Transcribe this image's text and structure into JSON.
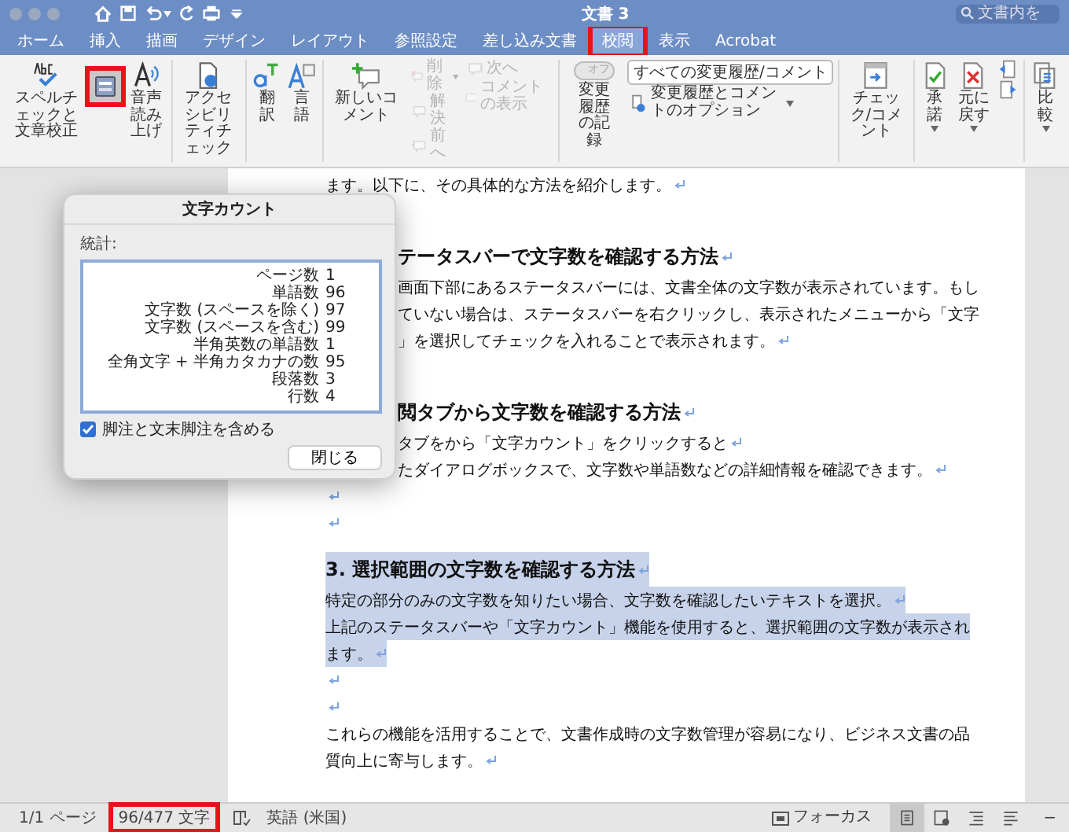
{
  "window": {
    "title": "文書 3",
    "search": {
      "placeholder": "文書内を"
    }
  },
  "quick_access": [
    {
      "caret": false
    },
    {
      "caret": false
    },
    {
      "caret": true
    },
    {
      "caret": false
    },
    {
      "caret": false
    },
    {
      "caret": false
    }
  ],
  "tabs": [
    {
      "label": "ホーム",
      "selected": false,
      "highlighted": false
    },
    {
      "label": "挿入",
      "selected": false,
      "highlighted": false
    },
    {
      "label": "描画",
      "selected": false,
      "highlighted": false
    },
    {
      "label": "デザイン",
      "selected": false,
      "highlighted": false
    },
    {
      "label": "レイアウト",
      "selected": false,
      "highlighted": false
    },
    {
      "label": "参照設定",
      "selected": false,
      "highlighted": false
    },
    {
      "label": "差し込み文書",
      "selected": false,
      "highlighted": false
    },
    {
      "label": "校閲",
      "selected": true,
      "highlighted": true
    },
    {
      "label": "表示",
      "selected": false,
      "highlighted": false
    },
    {
      "label": "Acrobat",
      "selected": false,
      "highlighted": false
    }
  ],
  "ribbon": {
    "groups": [
      {
        "items": [
          {
            "kind": "large",
            "label": "スペルチェックと文章校正",
            "disabled": false,
            "caret": false,
            "highlighted": false
          },
          {
            "kind": "large",
            "disabled": false,
            "caret": false,
            "highlighted": true
          },
          {
            "kind": "large",
            "label": "音声読み上げ",
            "disabled": false,
            "caret": false,
            "highlighted": false
          }
        ]
      },
      {
        "items": [
          {
            "kind": "large",
            "label": "アクセシビリティチェック",
            "disabled": false,
            "caret": false,
            "highlighted": false
          }
        ]
      },
      {
        "items": [
          {
            "kind": "large",
            "label": "翻訳",
            "disabled": false,
            "caret": false,
            "highlighted": false
          },
          {
            "kind": "large",
            "label": "言語",
            "disabled": false,
            "caret": false,
            "highlighted": false
          }
        ]
      },
      {
        "items": [
          {
            "kind": "large",
            "label": "新しいコメント",
            "disabled": false,
            "caret": false,
            "highlighted": false
          },
          {
            "kind": "column",
            "items": [
              {
                "kind": "small",
                "label": "削除",
                "disabled": true,
                "caret": true
              },
              {
                "kind": "small",
                "label": "解決",
                "disabled": true,
                "caret": false
              },
              {
                "kind": "small",
                "label": "前へ",
                "disabled": true,
                "caret": false
              }
            ]
          },
          {
            "kind": "column",
            "items": [
              {
                "kind": "small",
                "label": "次へ",
                "disabled": true,
                "caret": false
              },
              {
                "kind": "small",
                "label": "コメントの表示",
                "disabled": true,
                "caret": false
              }
            ]
          }
        ]
      },
      {
        "items": [
          {
            "kind": "toggle",
            "text": "オフ",
            "on": false,
            "label": "変更履歴の記録"
          },
          {
            "kind": "column",
            "items": [
              {
                "kind": "dropdown",
                "value": "すべての変更履歴/コメント"
              },
              {
                "kind": "small",
                "label": "変更履歴とコメントのオプション",
                "disabled": false,
                "caret": true
              }
            ]
          }
        ]
      },
      {
        "items": [
          {
            "kind": "large",
            "label": "チェック/コメント",
            "disabled": false,
            "caret": false,
            "highlighted": false
          }
        ]
      },
      {
        "items": [
          {
            "kind": "large",
            "label": "承諾",
            "disabled": false,
            "caret": true,
            "highlighted": false
          },
          {
            "kind": "large",
            "label": "元に戻す",
            "disabled": false,
            "caret": true,
            "highlighted": false
          },
          {
            "kind": "column",
            "items": [
              {
                "kind": "small",
                "disabled": false,
                "caret": false
              },
              {
                "kind": "small",
                "disabled": false,
                "caret": false
              }
            ]
          }
        ]
      },
      {
        "items": [
          {
            "kind": "large",
            "label": "比較",
            "disabled": false,
            "caret": true,
            "highlighted": false
          }
        ]
      }
    ]
  },
  "document": {
    "lines": [
      {
        "kind": "body",
        "text": "ます。以下に、その具体的な方法を紹介します。",
        "return_mark": true,
        "selected": false
      },
      {
        "kind": "heading",
        "text": "テータスバーで文字数を確認する方法",
        "return_mark": true,
        "selected": false,
        "covered": true
      },
      {
        "kind": "body",
        "text": "画面下部にあるステータスバーには、文書全体の文字数が表示されています。もし",
        "return_mark": false,
        "selected": false,
        "covered": true
      },
      {
        "kind": "body",
        "text": "ていない場合は、ステータスバーを右クリックし、表示されたメニューから「文字",
        "return_mark": false,
        "selected": false,
        "covered": true
      },
      {
        "kind": "body",
        "text": "」を選択してチェックを入れることで表示されます。",
        "return_mark": true,
        "selected": false,
        "covered": true
      },
      {
        "kind": "heading",
        "text": "閲タブから文字数を確認する方法",
        "return_mark": true,
        "selected": false,
        "covered": true
      },
      {
        "kind": "body",
        "text": "タブをから「文字カウント」をクリックすると",
        "return_mark": true,
        "selected": false,
        "covered": true
      },
      {
        "kind": "body",
        "text": "たダイアログボックスで、文字数や単語数などの詳細情報を確認できます。",
        "return_mark": true,
        "selected": false,
        "covered": true
      },
      {
        "kind": "blank",
        "return_mark": true,
        "selected": false
      },
      {
        "kind": "blank",
        "return_mark": true,
        "selected": false
      },
      {
        "kind": "heading",
        "text": "3. 選択範囲の文字数を確認する方法",
        "return_mark": true,
        "selected": true
      },
      {
        "kind": "body",
        "text": "特定の部分のみの文字数を知りたい場合、文字数を確認したいテキストを選択。",
        "return_mark": true,
        "selected": true
      },
      {
        "kind": "body",
        "text": "上記のステータスバーや「文字カウント」機能を使用すると、選択範囲の文字数が表示され",
        "return_mark": false,
        "selected": true
      },
      {
        "kind": "body",
        "text": "ます。",
        "return_mark": true,
        "selected": true
      },
      {
        "kind": "blank",
        "return_mark": true,
        "selected": false
      },
      {
        "kind": "blank",
        "return_mark": true,
        "selected": false
      },
      {
        "kind": "body",
        "text": "これらの機能を活用することで、文書作成時の文字数管理が容易になり、ビジネス文書の品",
        "return_mark": false,
        "selected": false
      },
      {
        "kind": "body",
        "text": "質向上に寄与します。",
        "return_mark": true,
        "selected": false
      }
    ]
  },
  "dialog": {
    "title": "文字カウント",
    "label": "統計:",
    "stats": [
      {
        "label": "ページ数",
        "value": "1"
      },
      {
        "label": "単語数",
        "value": "96"
      },
      {
        "label": "文字数 (スペースを除く)",
        "value": "97"
      },
      {
        "label": "文字数 (スペースを含む)",
        "value": "99"
      },
      {
        "label": "半角英数の単語数",
        "value": "1"
      },
      {
        "label": "全角文字 + 半角カタカナの数",
        "value": "95"
      },
      {
        "label": "段落数",
        "value": "3"
      },
      {
        "label": "行数",
        "value": "4"
      }
    ],
    "checkbox": {
      "label": "脚注と文末脚注を含める",
      "checked": true
    },
    "button": "閉じる"
  },
  "status_bar": {
    "page": "1/1 ページ",
    "word_count": {
      "text": "96/477 文字",
      "highlighted": true
    },
    "language": "英語 (米国)",
    "focus": "フォーカス",
    "views": [
      {
        "selected": true
      },
      {
        "selected": false
      },
      {
        "selected": false
      },
      {
        "selected": false
      }
    ],
    "zoom": "−"
  }
}
